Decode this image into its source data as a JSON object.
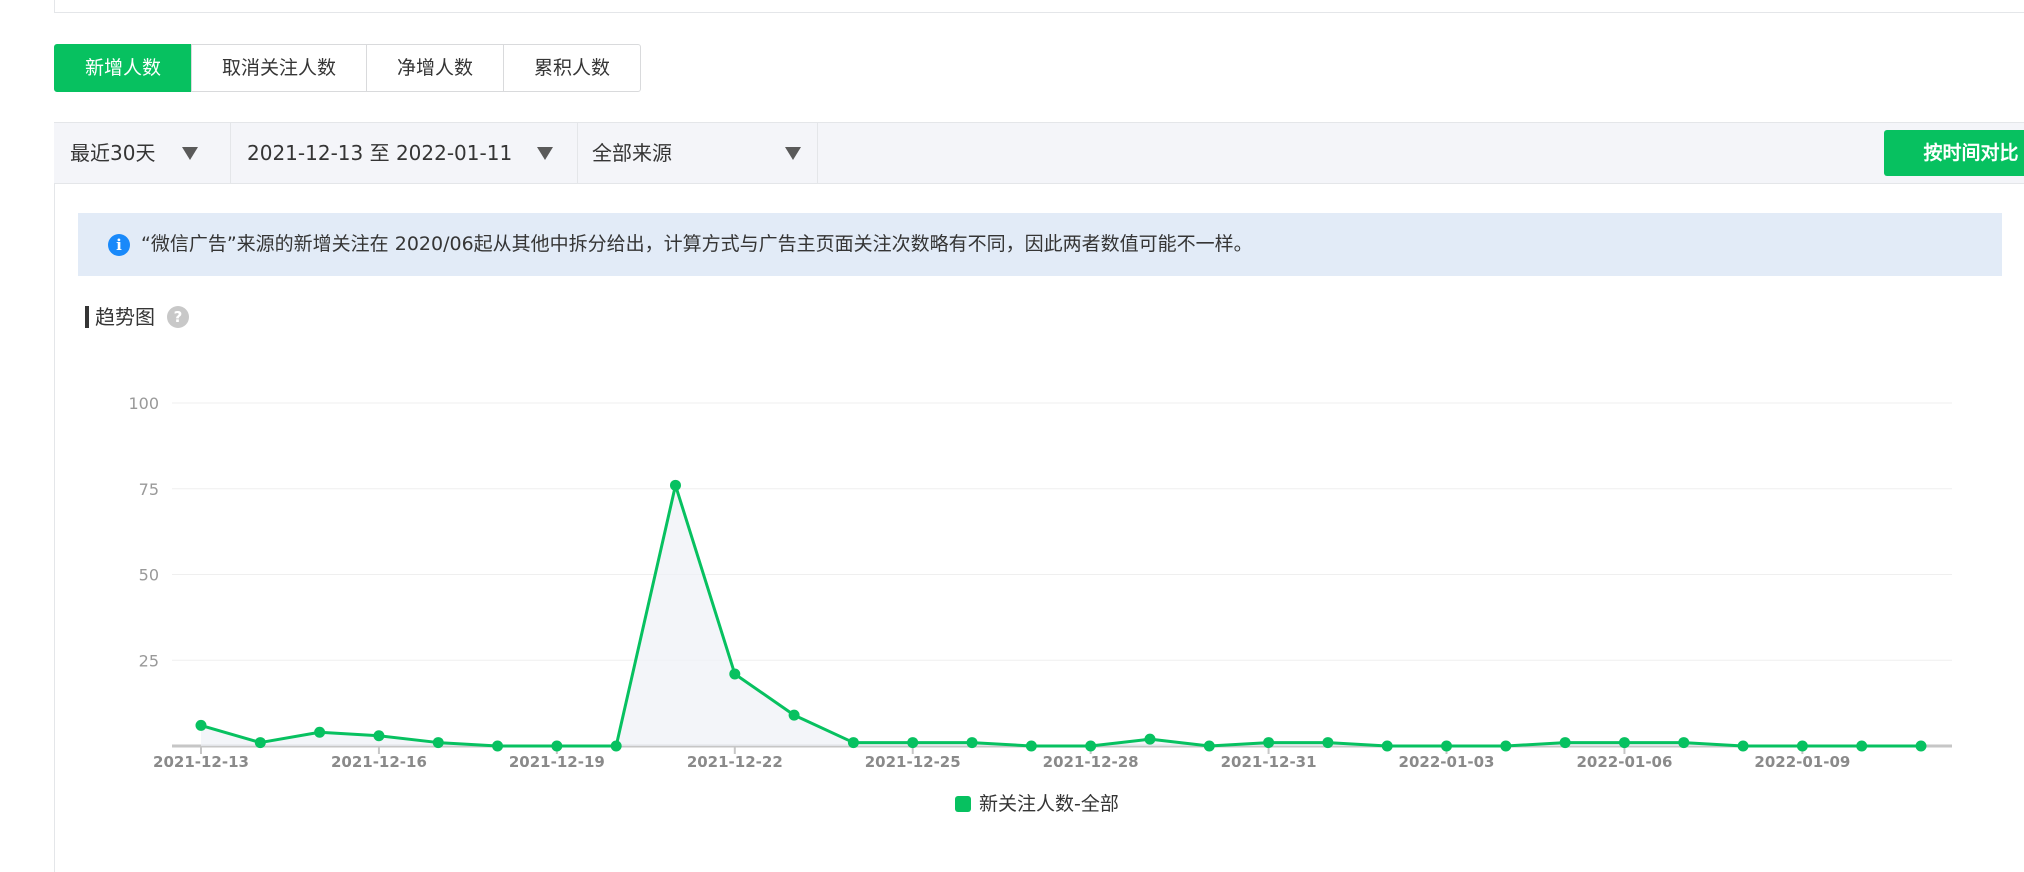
{
  "tabs": [
    {
      "label": "新增人数",
      "active": true
    },
    {
      "label": "取消关注人数",
      "active": false
    },
    {
      "label": "净增人数",
      "active": false
    },
    {
      "label": "累积人数",
      "active": false
    }
  ],
  "filters": {
    "period": "最近30天",
    "date_range": "2021-12-13 至 2022-01-11",
    "source": "全部来源",
    "compare_button": "按时间对比"
  },
  "notice": {
    "icon": "info-icon",
    "text": "“微信广告”来源的新增关注在 2020/06起从其他中拆分给出，计算方式与广告主页面关注次数略有不同，因此两者数值可能不一样。"
  },
  "trend": {
    "title": "趋势图",
    "help_icon": "question-icon",
    "help_glyph": "?"
  },
  "colors": {
    "accent": "#07c160",
    "notice_bg": "#e2ebf7",
    "info_blue": "#1989fa"
  },
  "chart_data": {
    "type": "line",
    "x": [
      "2021-12-13",
      "2021-12-14",
      "2021-12-15",
      "2021-12-16",
      "2021-12-17",
      "2021-12-18",
      "2021-12-19",
      "2021-12-20",
      "2021-12-21",
      "2021-12-22",
      "2021-12-23",
      "2021-12-24",
      "2021-12-25",
      "2021-12-26",
      "2021-12-27",
      "2021-12-28",
      "2021-12-29",
      "2021-12-30",
      "2021-12-31",
      "2022-01-01",
      "2022-01-02",
      "2022-01-03",
      "2022-01-04",
      "2022-01-05",
      "2022-01-06",
      "2022-01-07",
      "2022-01-08",
      "2022-01-09",
      "2022-01-10",
      "2022-01-11"
    ],
    "x_tick_labels": [
      "2021-12-13",
      "2021-12-16",
      "2021-12-19",
      "2021-12-22",
      "2021-12-25",
      "2021-12-28",
      "2021-12-31",
      "2022-01-03",
      "2022-01-06",
      "2022-01-09"
    ],
    "y_ticks": [
      "25",
      "50",
      "75",
      "100"
    ],
    "ylim": [
      0,
      100
    ],
    "grid": true,
    "legend_position": "bottom",
    "series": [
      {
        "name": "新关注人数-全部",
        "color": "#07c160",
        "values": [
          6,
          1,
          4,
          3,
          1,
          0,
          0,
          0,
          76,
          21,
          9,
          1,
          1,
          1,
          0,
          0,
          2,
          0,
          1,
          1,
          0,
          0,
          0,
          1,
          1,
          1,
          0,
          0,
          0,
          0
        ]
      }
    ]
  }
}
